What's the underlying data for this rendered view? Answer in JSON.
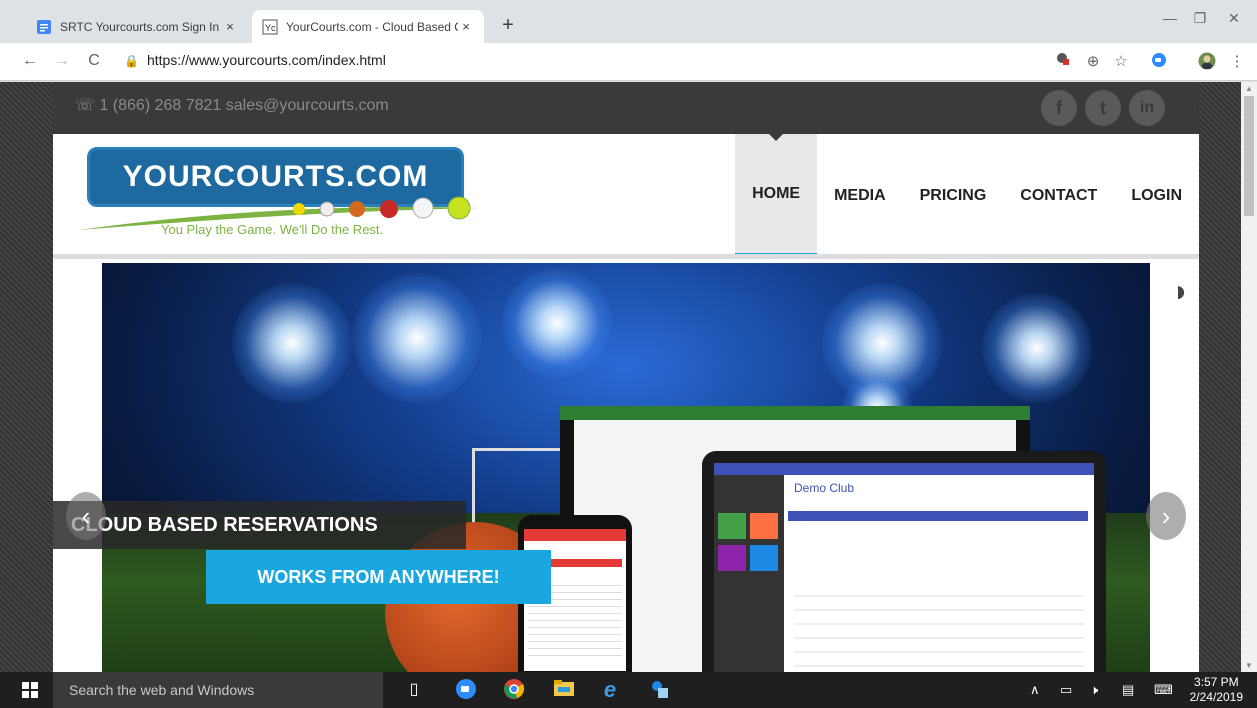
{
  "browser": {
    "tabs": [
      {
        "title": "SRTC Yourcourts.com Sign In che",
        "close": "×",
        "favicon": "doc-icon"
      },
      {
        "title": "YourCourts.com - Cloud Based C",
        "close": "×",
        "favicon": "yc-icon"
      }
    ],
    "new_tab": "+",
    "window": {
      "minimize": "—",
      "restore": "❐",
      "close": "✕"
    },
    "url": "https://www.yourcourts.com/index.html",
    "nav": {
      "back": "←",
      "forward": "→",
      "reload": "C",
      "zoom": "⊕",
      "star": "☆",
      "menu": "⋮"
    }
  },
  "site": {
    "contact": "1 (866) 268 7821 sales@yourcourts.com",
    "social": [
      "f",
      "t",
      "in"
    ],
    "logo_text": "YOURCOURTS.COM",
    "tagline": "You Play the Game. We'll Do the Rest.",
    "nav": [
      "HOME",
      "MEDIA",
      "PRICING",
      "CONTACT",
      "LOGIN"
    ],
    "active_nav": "HOME",
    "slide": {
      "caption1": "CLOUD BASED RESERVATIONS",
      "caption2": "WORKS FROM ANYWHERE!",
      "prev": "‹",
      "next": "›",
      "app_title": "Demo Club"
    }
  },
  "taskbar": {
    "search_placeholder": "Search the web and Windows",
    "time": "3:57 PM",
    "date": "2/24/2019"
  },
  "colors": {
    "accent": "#19a6df",
    "logo_blue": "#1e6aa0",
    "tagline_green": "#7cb342"
  }
}
